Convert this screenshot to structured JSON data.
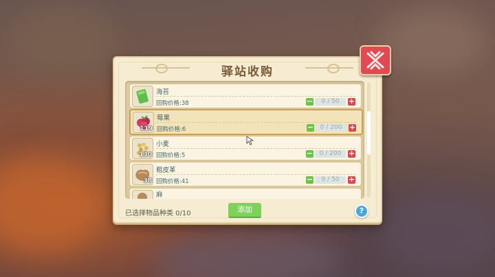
{
  "dialog": {
    "title": "驿站收购",
    "selected_types_label": "已选择物品种类 0/10",
    "add_button": "添加",
    "help_button": "?"
  },
  "items": [
    {
      "name": "海苔",
      "price": "回购价格:38",
      "count": "",
      "qty": "0 / 50",
      "icon": "seaweed-icon"
    },
    {
      "name": "莓果",
      "price": "回购价格:6",
      "count": "119",
      "qty": "0 / 200",
      "icon": "berry-icon"
    },
    {
      "name": "小麦",
      "price": "回购价格:5",
      "count": "130",
      "qty": "0 / 200",
      "icon": "wheat-icon"
    },
    {
      "name": "粗皮革",
      "price": "回购价格:41",
      "count": "38",
      "qty": "0 / 50",
      "icon": "leather-icon"
    },
    {
      "name": "麻",
      "price": "",
      "count": "",
      "qty": "",
      "icon": "hemp-icon"
    }
  ],
  "colors": {
    "panel": "#f6ecd2",
    "close": "#e04a52",
    "minus": "#6cc24a",
    "plus": "#e0454a",
    "add": "#7dd35a",
    "help": "#4aa6de"
  }
}
